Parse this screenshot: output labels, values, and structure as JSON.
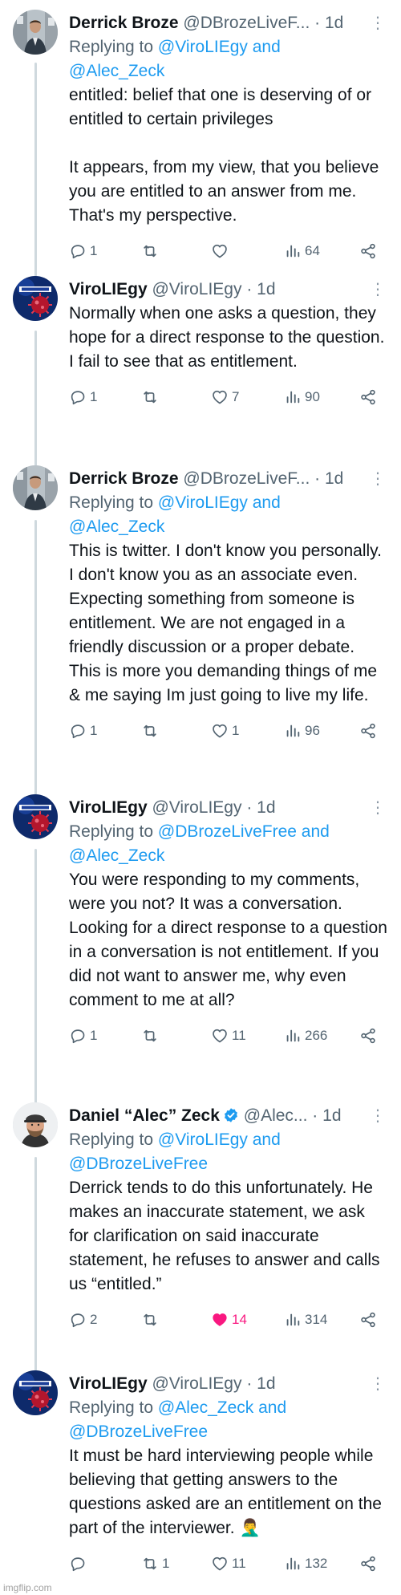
{
  "thread": [
    {
      "name": "Derrick Broze",
      "handle": "@DBrozeLiveF...",
      "separator": "·",
      "time": "1d",
      "verified": false,
      "replying_prefix": "Replying to ",
      "replying_to_1": "@ViroLIEgy and",
      "replying_to_2": "@Alec_Zeck",
      "text": [
        "entitled: belief that one is deserving of or entitled to certain privileges",
        "It appears, from my view, that you believe you are entitled to an answer from me. That's my perspective."
      ],
      "replies": "1",
      "retweets": "",
      "likes": "",
      "views": "64",
      "liked": false,
      "avatar": "derrick-avatar"
    },
    {
      "name": "ViroLIEgy",
      "handle": "@ViroLIEgy",
      "separator": "·",
      "time": "1d",
      "verified": false,
      "text": [
        "Normally when one asks a question, they hope for a direct response to the question. I fail to see that as entitlement."
      ],
      "replies": "1",
      "retweets": "",
      "likes": "7",
      "views": "90",
      "liked": false,
      "avatar": "virology-avatar"
    },
    {
      "name": "Derrick Broze",
      "handle": "@DBrozeLiveF...",
      "separator": "·",
      "time": "1d",
      "verified": false,
      "replying_prefix": "Replying to ",
      "replying_to_1": "@ViroLIEgy and",
      "replying_to_2": "@Alec_Zeck",
      "text": [
        "This is twitter. I don't know you personally. I don't know you as an associate even. Expecting something from someone is entitlement. We are not engaged in a friendly discussion or a proper debate. This is more you demanding things of me & me saying Im just going to live my life."
      ],
      "replies": "1",
      "retweets": "",
      "likes": "1",
      "views": "96",
      "liked": false,
      "avatar": "derrick-avatar"
    },
    {
      "name": "ViroLIEgy",
      "handle": "@ViroLIEgy",
      "separator": "·",
      "time": "1d",
      "verified": false,
      "replying_prefix": "Replying to ",
      "replying_to_1": "@DBrozeLiveFree and",
      "replying_to_2": "@Alec_Zeck",
      "text": [
        "You were responding to my comments, were you not? It was a conversation. Looking for a direct response to a question in a conversation is not entitlement. If you did not want to answer me, why even comment to me at all?"
      ],
      "replies": "1",
      "retweets": "",
      "likes": "11",
      "views": "266",
      "liked": false,
      "avatar": "virology-avatar"
    },
    {
      "name": "Daniel “Alec” Zeck",
      "handle": "@Alec...",
      "separator": "·",
      "time": "1d",
      "verified": true,
      "replying_prefix": "Replying to ",
      "replying_to_1": "@ViroLIEgy and",
      "replying_to_2": "@DBrozeLiveFree",
      "text": [
        "Derrick tends to do this unfortunately. He makes an inaccurate statement, we ask for clarification on said inaccurate statement, he refuses to answer and calls us “entitled.”"
      ],
      "replies": "2",
      "retweets": "",
      "likes": "14",
      "views": "314",
      "liked": true,
      "avatar": "alec-avatar"
    },
    {
      "name": "ViroLIEgy",
      "handle": "@ViroLIEgy",
      "separator": "·",
      "time": "1d",
      "verified": false,
      "replying_prefix": "Replying to ",
      "replying_to_1": "@Alec_Zeck and",
      "replying_to_2": "@DBrozeLiveFree",
      "text": [
        "It must be hard interviewing people while believing that getting answers to the questions asked are an entitlement on the part of the interviewer. 🤦‍♂️"
      ],
      "replies": "",
      "retweets": "1",
      "likes": "11",
      "views": "132",
      "liked": false,
      "avatar": "virology-avatar"
    }
  ],
  "colors": {
    "link": "#1d9bf0",
    "muted": "#536471",
    "like_active": "#f91880",
    "thread_line": "#cfd9de"
  },
  "watermark": "imgflip.com"
}
